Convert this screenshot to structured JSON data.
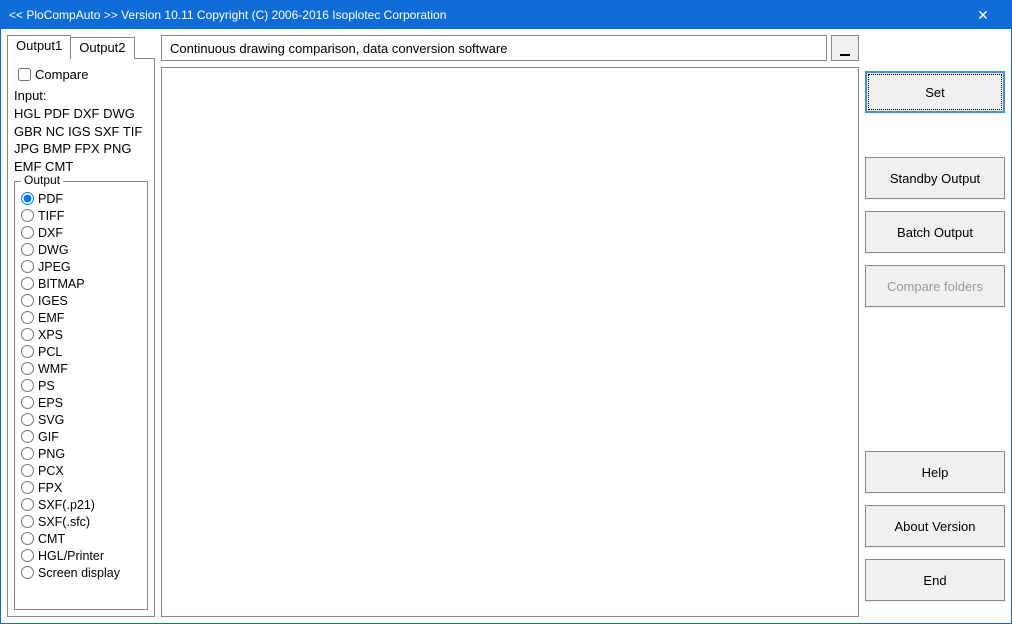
{
  "window": {
    "title": "<< PloCompAuto >>   Version 10.11 Copyright (C) 2006-2016 Isoplotec Corporation"
  },
  "tabs": {
    "output1": "Output1",
    "output2": "Output2"
  },
  "compare": {
    "label": "Compare",
    "checked": false
  },
  "input": {
    "label": "Input:",
    "line1": "HGL PDF DXF DWG",
    "line2": "GBR NC  IGS SXF TIF",
    "line3": "JPG BMP FPX PNG",
    "line4": "EMF CMT"
  },
  "output_group": {
    "legend": "Output",
    "options": [
      "PDF",
      "TIFF",
      "DXF",
      "DWG",
      "JPEG",
      "BITMAP",
      "IGES",
      "EMF",
      "XPS",
      "PCL",
      "WMF",
      "PS",
      "EPS",
      "SVG",
      "GIF",
      "PNG",
      "PCX",
      "FPX",
      "SXF(.p21)",
      "SXF(.sfc)",
      "CMT",
      "HGL/Printer",
      "Screen display"
    ],
    "selected": "PDF"
  },
  "description": "Continuous drawing comparison, data conversion software",
  "buttons": {
    "set": "Set",
    "standby": "Standby Output",
    "batch": "Batch Output",
    "compare_folders": "Compare folders",
    "help": "Help",
    "about": "About Version",
    "end": "End"
  }
}
